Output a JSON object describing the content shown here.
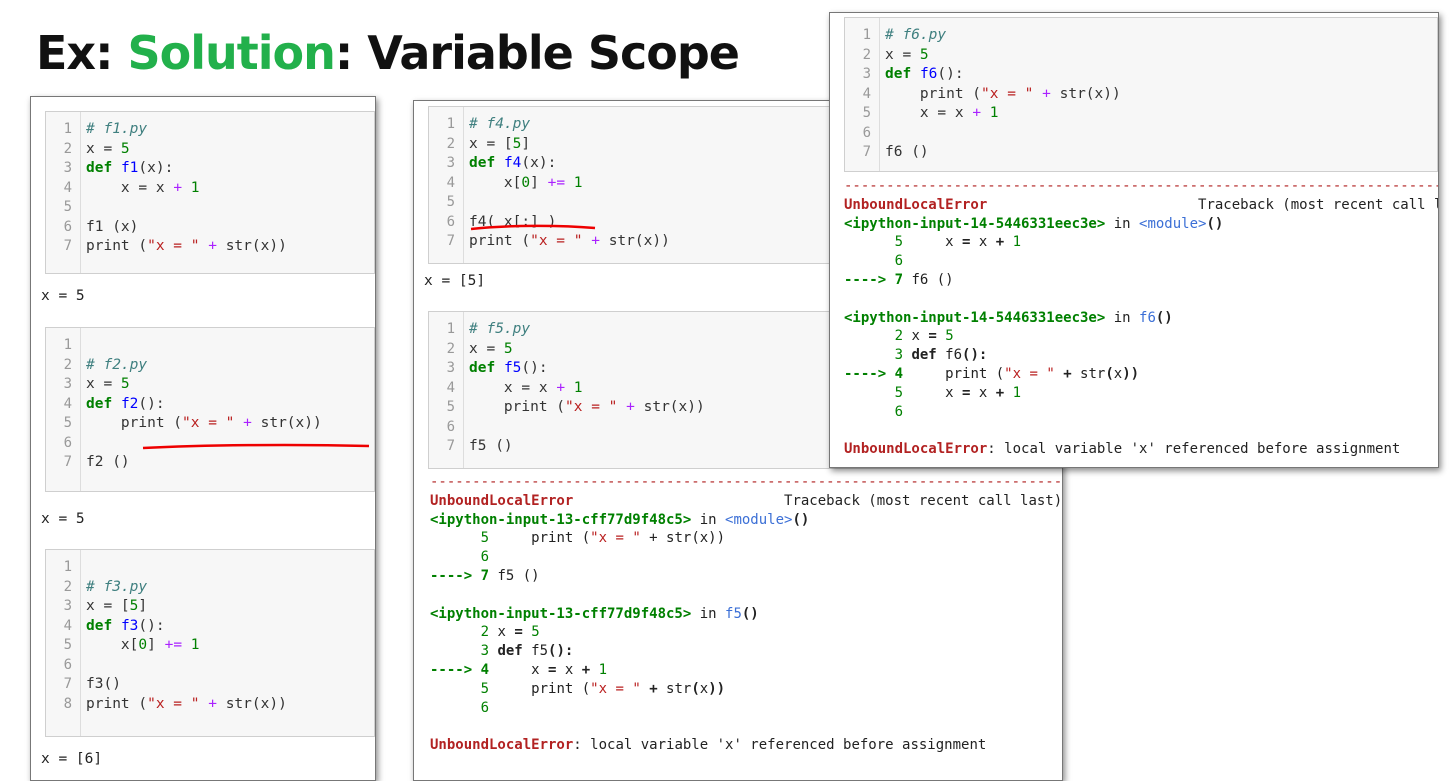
{
  "title": {
    "prefix": "Ex: ",
    "accent": "Solution",
    "suffix": ": Variable Scope"
  },
  "accent_color": "#22b04b",
  "panel1": {
    "f1": {
      "lines": [
        {
          "n": "1",
          "html": "<span class='cm'># f1.py</span>"
        },
        {
          "n": "2",
          "html": "x = <span class='num'>5</span>"
        },
        {
          "n": "3",
          "html": "<span class='kw'>def</span> <span class='fn'>f1</span>(x):"
        },
        {
          "n": "4",
          "html": "    x = x <span class='op'>+</span> <span class='num'>1</span>"
        },
        {
          "n": "5",
          "html": ""
        },
        {
          "n": "6",
          "html": "f1 (x)"
        },
        {
          "n": "7",
          "html": "print (<span class='st'>\"x = \"</span> <span class='op'>+</span> str(x))"
        }
      ],
      "output": "x = 5"
    },
    "f2": {
      "lines": [
        {
          "n": "1",
          "html": ""
        },
        {
          "n": "2",
          "html": "<span class='cm'># f2.py</span>"
        },
        {
          "n": "3",
          "html": "x = <span class='num'>5</span>"
        },
        {
          "n": "4",
          "html": "<span class='kw'>def</span> <span class='fn'>f2</span>():"
        },
        {
          "n": "5",
          "html": "    print (<span class='st'>\"x = \"</span> <span class='op'>+</span> str(x))"
        },
        {
          "n": "6",
          "html": ""
        },
        {
          "n": "7",
          "html": "f2 ()"
        }
      ],
      "output": "x = 5"
    },
    "f3": {
      "lines": [
        {
          "n": "1",
          "html": ""
        },
        {
          "n": "2",
          "html": "<span class='cm'># f3.py</span>"
        },
        {
          "n": "3",
          "html": "x = [<span class='num'>5</span>]"
        },
        {
          "n": "4",
          "html": "<span class='kw'>def</span> <span class='fn'>f3</span>():"
        },
        {
          "n": "5",
          "html": "    x[<span class='num'>0</span>] <span class='op'>+=</span> <span class='num'>1</span>"
        },
        {
          "n": "6",
          "html": ""
        },
        {
          "n": "7",
          "html": "f3()"
        },
        {
          "n": "8",
          "html": "print (<span class='st'>\"x = \"</span> <span class='op'>+</span> str(x))"
        }
      ],
      "output": "x = [6]"
    }
  },
  "panel2": {
    "f4": {
      "lines": [
        {
          "n": "1",
          "html": "<span class='cm'># f4.py</span>"
        },
        {
          "n": "2",
          "html": "x = [<span class='num'>5</span>]"
        },
        {
          "n": "3",
          "html": "<span class='kw'>def</span> <span class='fn'>f4</span>(x):"
        },
        {
          "n": "4",
          "html": "    x[<span class='num'>0</span>] <span class='op'>+=</span> <span class='num'>1</span>"
        },
        {
          "n": "5",
          "html": ""
        },
        {
          "n": "6",
          "html": "f4( x[:] )"
        },
        {
          "n": "7",
          "html": "print (<span class='st'>\"x = \"</span> <span class='op'>+</span> str(x))"
        }
      ],
      "output": "x = [5]"
    },
    "f5": {
      "lines": [
        {
          "n": "1",
          "html": "<span class='cm'># f5.py</span>"
        },
        {
          "n": "2",
          "html": "x = <span class='num'>5</span>"
        },
        {
          "n": "3",
          "html": "<span class='kw'>def</span> <span class='fn'>f5</span>():"
        },
        {
          "n": "4",
          "html": "    x = x <span class='op'>+</span> <span class='num'>1</span>"
        },
        {
          "n": "5",
          "html": "    print (<span class='st'>\"x = \"</span> <span class='op'>+</span> str(x))"
        },
        {
          "n": "6",
          "html": ""
        },
        {
          "n": "7",
          "html": "f5 ()"
        }
      ],
      "traceback": [
        "<span class='dashes'>---------------------------------------------------------------------------</span>",
        "<span class='err'>UnboundLocalError</span>                         Traceback (most recent call last)",
        "<span class='gn bold'>&lt;ipython-input-13-cff77d9f48c5&gt;</span> in <span class='bl'>&lt;module&gt;</span><span class='bold'>()</span>",
        "<span class='gn'>      5</span>     print (<span class='st'>\"x = \"</span> + str(x))",
        "<span class='gn'>      6</span>",
        "<span class='arrow'>----&gt; 7</span> f5 ()",
        "",
        "<span class='gn bold'>&lt;ipython-input-13-cff77d9f48c5&gt;</span> in <span class='bl'>f5</span><span class='bold'>()</span>",
        "<span class='gn'>      2</span> x <span class='bold'>=</span> <span class='gn'>5</span>",
        "<span class='gn'>      3</span> <span class='bold'>def</span> f5<span class='bold'>():</span>",
        "<span class='arrow'>----&gt; 4</span>     x <span class='bold'>=</span> x <span class='bold'>+</span> <span class='gn'>1</span>",
        "<span class='gn'>      5</span>     print (<span class='st'>\"x = \"</span> <span class='bold'>+</span> str<span class='bold'>(</span>x<span class='bold'>))</span>",
        "<span class='gn'>      6</span>",
        "",
        "<span class='err'>UnboundLocalError</span>: local variable 'x' referenced before assignment"
      ]
    }
  },
  "panel3": {
    "f6": {
      "lines": [
        {
          "n": "1",
          "html": "<span class='cm'># f6.py</span>"
        },
        {
          "n": "2",
          "html": "x = <span class='num'>5</span>"
        },
        {
          "n": "3",
          "html": "<span class='kw'>def</span> <span class='fn'>f6</span>():"
        },
        {
          "n": "4",
          "html": "    print (<span class='st'>\"x = \"</span> <span class='op'>+</span> str(x))"
        },
        {
          "n": "5",
          "html": "    x = x <span class='op'>+</span> <span class='num'>1</span>"
        },
        {
          "n": "6",
          "html": ""
        },
        {
          "n": "7",
          "html": "f6 ()"
        }
      ],
      "traceback": [
        "<span class='dashes'>---------------------------------------------------------------------------</span>",
        "<span class='err'>UnboundLocalError</span>                         Traceback (most recent call last)",
        "<span class='gn bold'>&lt;ipython-input-14-5446331eec3e&gt;</span> in <span class='bl'>&lt;module&gt;</span><span class='bold'>()</span>",
        "<span class='gn'>      5</span>     x <span class='bold'>=</span> x <span class='bold'>+</span> <span class='gn'>1</span>",
        "<span class='gn'>      6</span>",
        "<span class='arrow'>----&gt; 7</span> f6 ()",
        "",
        "<span class='gn bold'>&lt;ipython-input-14-5446331eec3e&gt;</span> in <span class='bl'>f6</span><span class='bold'>()</span>",
        "<span class='gn'>      2</span> x <span class='bold'>=</span> <span class='gn'>5</span>",
        "<span class='gn'>      3</span> <span class='bold'>def</span> f6<span class='bold'>():</span>",
        "<span class='arrow'>----&gt; 4</span>     print (<span class='st'>\"x = \"</span> <span class='bold'>+</span> str<span class='bold'>(</span>x<span class='bold'>))</span>",
        "<span class='gn'>      5</span>     x <span class='bold'>=</span> x <span class='bold'>+</span> <span class='gn'>1</span>",
        "<span class='gn'>      6</span>",
        "",
        "<span class='err'>UnboundLocalError</span>: local variable 'x' referenced before assignment"
      ]
    }
  }
}
